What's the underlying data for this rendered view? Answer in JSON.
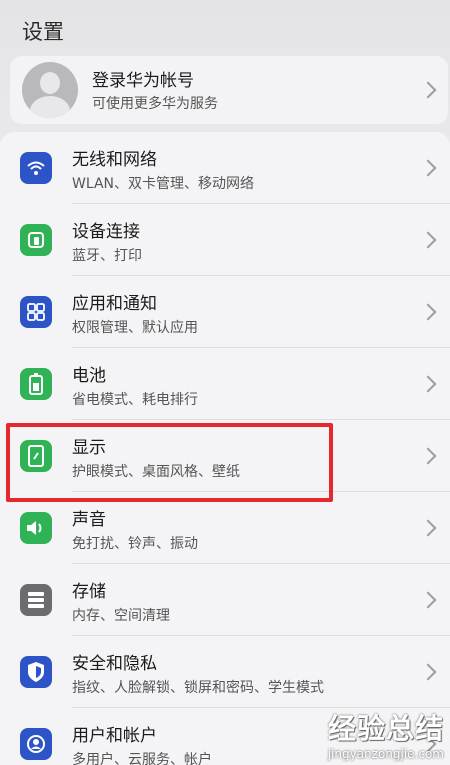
{
  "header": {
    "title": "设置"
  },
  "account": {
    "title": "登录华为帐号",
    "subtitle": "可使用更多华为服务",
    "icon": "avatar-icon"
  },
  "settings": [
    {
      "title": "无线和网络",
      "subtitle": "WLAN、双卡管理、移动网络",
      "icon": "wifi-icon",
      "color": "#2d54c7"
    },
    {
      "title": "设备连接",
      "subtitle": "蓝牙、打印",
      "icon": "device-connection-icon",
      "color": "#2fb356"
    },
    {
      "title": "应用和通知",
      "subtitle": "权限管理、默认应用",
      "icon": "apps-grid-icon",
      "color": "#2d54c7"
    },
    {
      "title": "电池",
      "subtitle": "省电模式、耗电排行",
      "icon": "battery-icon",
      "color": "#2fb356"
    },
    {
      "title": "显示",
      "subtitle": "护眼模式、桌面风格、壁纸",
      "icon": "display-icon",
      "color": "#2fb356",
      "highlighted": true
    },
    {
      "title": "声音",
      "subtitle": "免打扰、铃声、振动",
      "icon": "sound-icon",
      "color": "#2fb356"
    },
    {
      "title": "存储",
      "subtitle": "内存、空间清理",
      "icon": "storage-icon",
      "color": "#6b6b70"
    },
    {
      "title": "安全和隐私",
      "subtitle": "指纹、人脸解锁、锁屏和密码、学生模式",
      "icon": "shield-icon",
      "color": "#2d54c7"
    },
    {
      "title": "用户和帐户",
      "subtitle": "多用户、云服务、帐户",
      "icon": "user-icon",
      "color": "#2d54c7"
    }
  ],
  "highlight_color": "#e5282d",
  "watermark": {
    "main": "经验总结",
    "url": "jingyanzongjie.com"
  }
}
